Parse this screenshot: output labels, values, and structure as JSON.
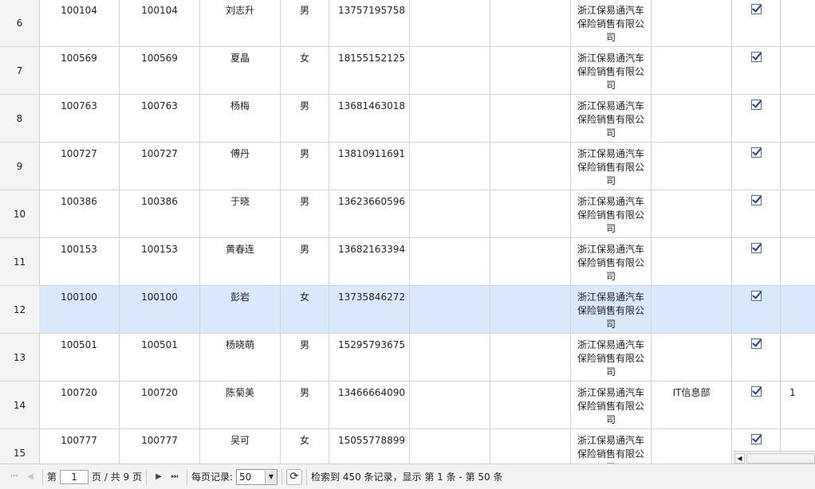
{
  "rows": [
    {
      "num": "6",
      "id1": "100104",
      "id2": "100104",
      "name": "刘志升",
      "gender": "男",
      "phone": "13757195758",
      "company": "浙江保易通汽车保险销售有限公司",
      "dept": "",
      "tail": ""
    },
    {
      "num": "7",
      "id1": "100569",
      "id2": "100569",
      "name": "夏晶",
      "gender": "女",
      "phone": "18155152125",
      "company": "浙江保易通汽车保险销售有限公司",
      "dept": "",
      "tail": ""
    },
    {
      "num": "8",
      "id1": "100763",
      "id2": "100763",
      "name": "杨梅",
      "gender": "男",
      "phone": "13681463018",
      "company": "浙江保易通汽车保险销售有限公司",
      "dept": "",
      "tail": ""
    },
    {
      "num": "9",
      "id1": "100727",
      "id2": "100727",
      "name": "傅丹",
      "gender": "男",
      "phone": "13810911691",
      "company": "浙江保易通汽车保险销售有限公司",
      "dept": "",
      "tail": ""
    },
    {
      "num": "10",
      "id1": "100386",
      "id2": "100386",
      "name": "于晓",
      "gender": "男",
      "phone": "13623660596",
      "company": "浙江保易通汽车保险销售有限公司",
      "dept": "",
      "tail": ""
    },
    {
      "num": "11",
      "id1": "100153",
      "id2": "100153",
      "name": "黄春连",
      "gender": "男",
      "phone": "13682163394",
      "company": "浙江保易通汽车保险销售有限公司",
      "dept": "",
      "tail": ""
    },
    {
      "num": "12",
      "id1": "100100",
      "id2": "100100",
      "name": "彭岩",
      "gender": "女",
      "phone": "13735846272",
      "company": "浙江保易通汽车保险销售有限公司",
      "dept": "",
      "tail": "",
      "selected": true
    },
    {
      "num": "13",
      "id1": "100501",
      "id2": "100501",
      "name": "杨晓萌",
      "gender": "男",
      "phone": "15295793675",
      "company": "浙江保易通汽车保险销售有限公司",
      "dept": "",
      "tail": ""
    },
    {
      "num": "14",
      "id1": "100720",
      "id2": "100720",
      "name": "陈菊美",
      "gender": "男",
      "phone": "13466664090",
      "company": "浙江保易通汽车保险销售有限公司",
      "dept": "IT信息部",
      "tail": "1"
    },
    {
      "num": "15",
      "id1": "100777",
      "id2": "100777",
      "name": "吴可",
      "gender": "女",
      "phone": "15055778899",
      "company": "浙江保易通汽车保险销售有限公司",
      "dept": "",
      "tail": ""
    }
  ],
  "pager": {
    "page_prefix": "第",
    "current_page": "1",
    "page_suffix": "页 / 共 9 页",
    "per_page_label": "每页记录:",
    "per_page_value": "50",
    "summary": "检索到 450 条记录，显示 第 1 条 - 第 50 条"
  },
  "icons": {
    "first": "first-page-icon",
    "prev": "prev-page-icon",
    "next": "next-page-icon",
    "last": "last-page-icon",
    "refresh": "refresh-icon",
    "checkbox": "checkbox-checked-icon"
  },
  "colors": {
    "selected_row": "#d9e8fb",
    "checkbox": "#1d3f9e"
  }
}
